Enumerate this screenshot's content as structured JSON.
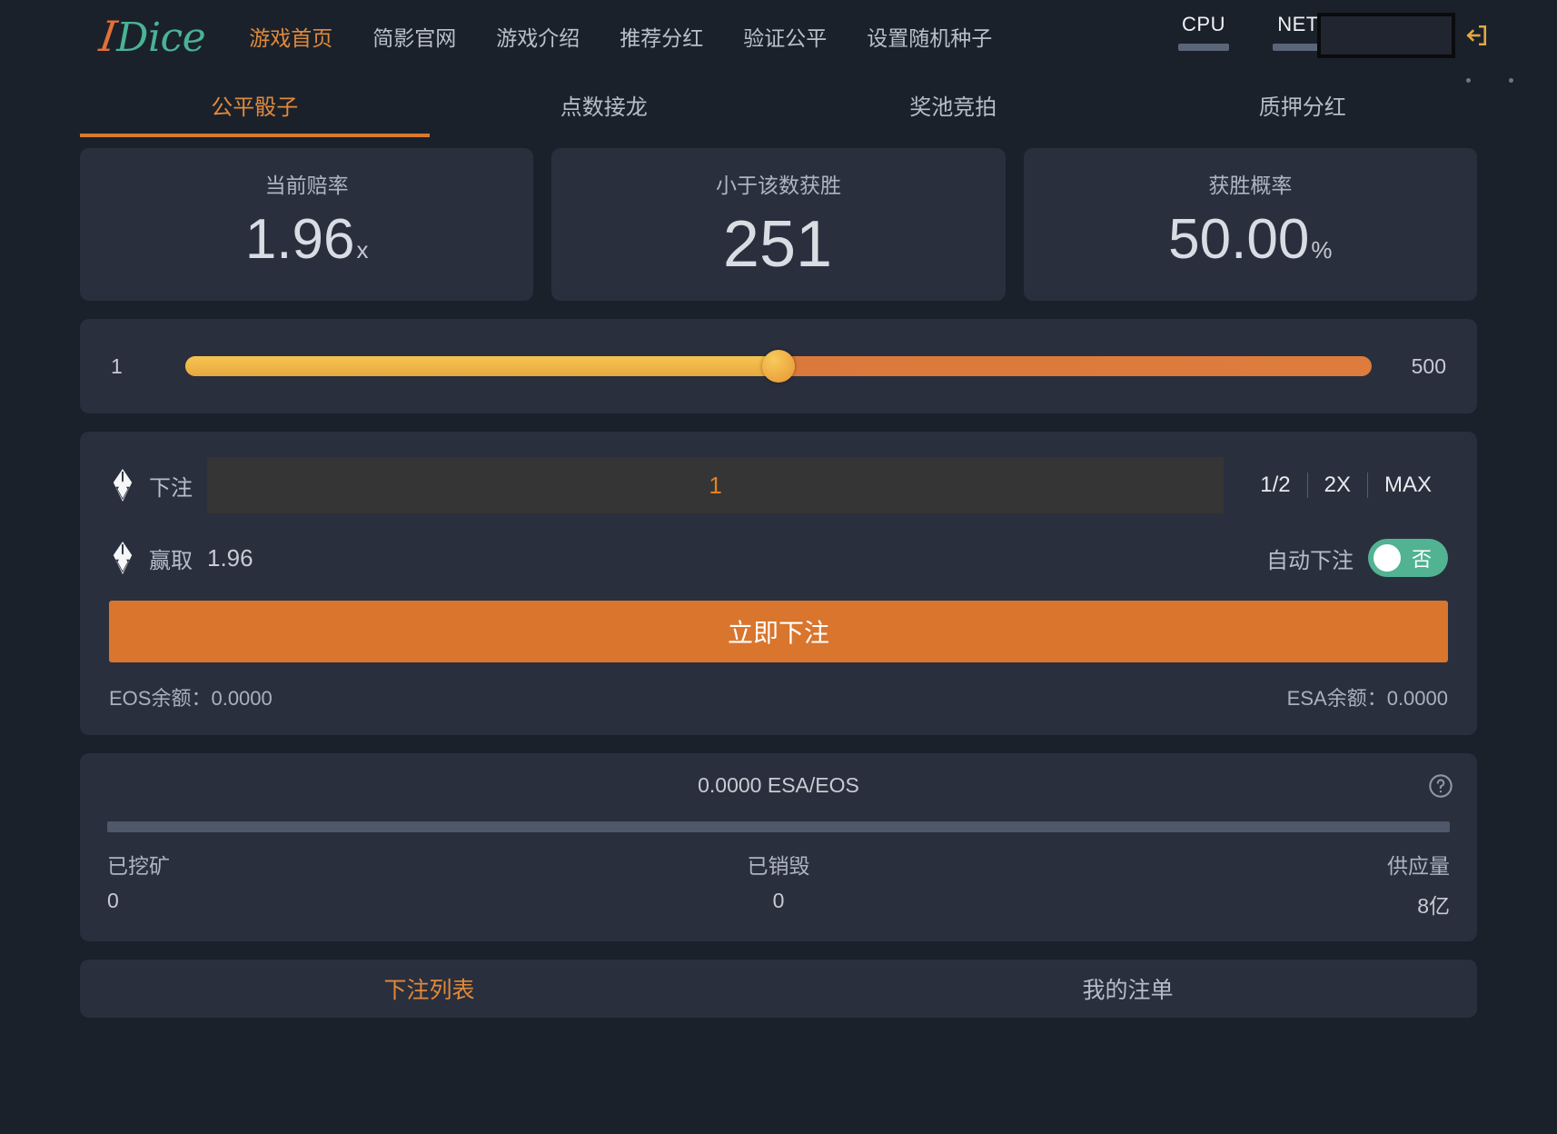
{
  "brand": {
    "prefix": "I",
    "name": "Dice"
  },
  "nav": {
    "items": [
      {
        "label": "游戏首页",
        "active": true
      },
      {
        "label": "简影官网",
        "active": false
      },
      {
        "label": "游戏介绍",
        "active": false
      },
      {
        "label": "推荐分红",
        "active": false
      },
      {
        "label": "验证公平",
        "active": false
      },
      {
        "label": "设置随机种子",
        "active": false
      }
    ]
  },
  "resources": [
    {
      "label": "CPU"
    },
    {
      "label": "NET"
    }
  ],
  "account": {
    "value": "",
    "placeholder": ""
  },
  "tabs": [
    {
      "label": "公平骰子",
      "active": true
    },
    {
      "label": "点数接龙",
      "active": false
    },
    {
      "label": "奖池竞拍",
      "active": false
    },
    {
      "label": "质押分红",
      "active": false
    }
  ],
  "stats": [
    {
      "title": "当前赔率",
      "value": "1.96",
      "unit": "x"
    },
    {
      "title": "小于该数获胜",
      "value": "251",
      "unit": ""
    },
    {
      "title": "获胜概率",
      "value": "50.00",
      "unit": "%"
    }
  ],
  "slider": {
    "min": "1",
    "max": "500",
    "value": 251,
    "percent": 50
  },
  "bet": {
    "label": "下注",
    "amount": "1",
    "placeholder": "1",
    "half_label": "1/2",
    "double_label": "2X",
    "max_label": "MAX",
    "win_label": "赢取",
    "win_value": "1.96",
    "auto_label": "自动下注",
    "auto_state": "否",
    "submit_label": "立即下注",
    "eos_balance_label": "EOS余额：",
    "eos_balance_value": "0.0000",
    "esa_balance_label": "ESA余额：",
    "esa_balance_value": "0.0000"
  },
  "mining": {
    "rate": "0.0000 ESA/EOS",
    "mined_label": "已挖矿",
    "mined_value": "0",
    "burned_label": "已销毁",
    "burned_value": "0",
    "supply_label": "供应量",
    "supply_value": "8亿",
    "progress_percent": 0
  },
  "bottom_tabs": [
    {
      "label": "下注列表",
      "active": true
    },
    {
      "label": "我的注单",
      "active": false
    }
  ],
  "icons": {
    "login": "login-icon",
    "eos": "eos-leaf-icon",
    "help": "help-circle-icon"
  },
  "colors": {
    "accent_orange": "#e08a3c",
    "button_orange": "#d9752c",
    "brand_teal": "#49b397",
    "brand_orange": "#e2703a",
    "toggle_green": "#52b393",
    "panel": "#2a2f3d",
    "background": "#1b212b"
  }
}
